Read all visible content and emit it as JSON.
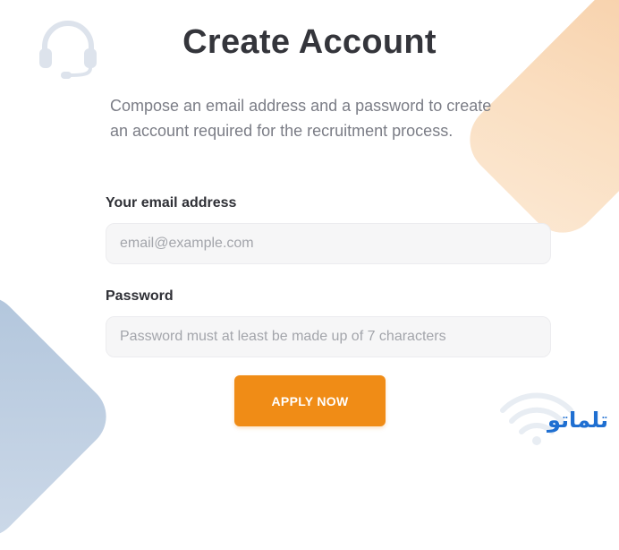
{
  "page": {
    "title": "Create Account",
    "description": "Compose an email address and a password to create an account required for the recruitment process."
  },
  "form": {
    "email": {
      "label": "Your email address",
      "placeholder": "email@example.com",
      "value": ""
    },
    "password": {
      "label": "Password",
      "placeholder": "Password must at least be made up of 7 characters",
      "value": ""
    },
    "submit_label": "APPLY NOW"
  },
  "branding": {
    "logo_text": "تلماتو"
  },
  "decorations": {
    "top_left_icon": "headset-icon",
    "bottom_right_icon": "wifi-icon"
  },
  "colors": {
    "accent": "#f08c16",
    "brand": "#1f6fd1",
    "heading": "#34353b",
    "muted_text": "#7b7d86"
  }
}
